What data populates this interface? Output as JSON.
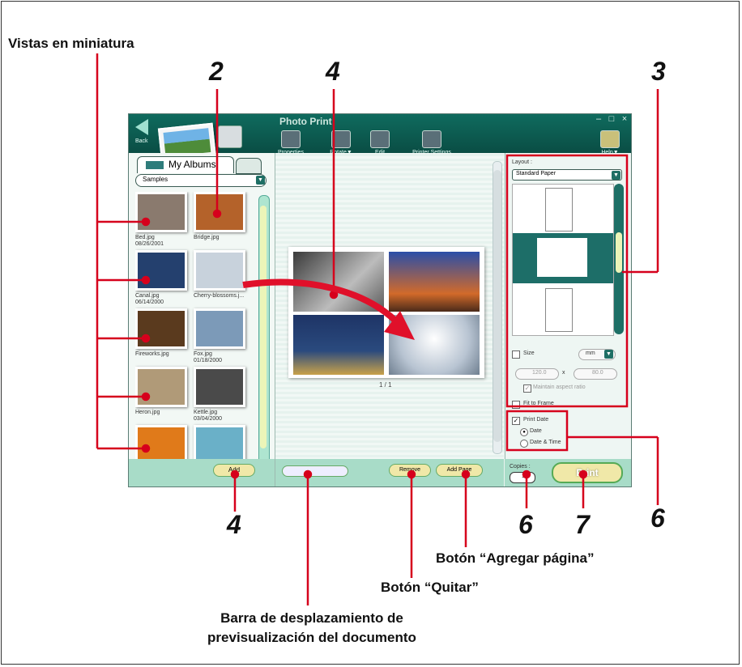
{
  "annotations": {
    "thumbnails_label": "Vistas en miniatura",
    "callout_2": "2",
    "callout_4_top": "4",
    "callout_3": "3",
    "callout_4_bottom": "4",
    "callout_6_right": "6",
    "callout_6_bottom": "6",
    "callout_7": "7",
    "add_page_label": "Botón “Agregar página”",
    "remove_label": "Botón “Quitar”",
    "scrollbar_caption_line1": "Barra de desplazamiento de",
    "scrollbar_caption_line2": "previsualización del documento"
  },
  "window": {
    "title": "Photo Print",
    "back_label": "Back",
    "help_label": "Help▼",
    "toolbar": [
      {
        "label": "Properties"
      },
      {
        "label": "Rotate▼"
      },
      {
        "label": "Edit"
      },
      {
        "label": "Printer Settings"
      }
    ]
  },
  "left_panel": {
    "tab_label": "My Albums",
    "album_select": "Samples",
    "thumbnails": [
      {
        "name": "Bed.jpg",
        "date": "08/26/2001",
        "color": "#8a7a6e"
      },
      {
        "name": "Bridge.jpg",
        "date": "",
        "color": "#b4622a"
      },
      {
        "name": "Canal.jpg",
        "date": "06/14/2000",
        "color": "#24406e"
      },
      {
        "name": "Cherry-blossoms.j...",
        "date": "",
        "color": "#c8d2dc"
      },
      {
        "name": "Fireworks.jpg",
        "date": "",
        "color": "#5a3a1e"
      },
      {
        "name": "Fox.jpg",
        "date": "01/18/2000",
        "color": "#7c9ab8"
      },
      {
        "name": "Heron.jpg",
        "date": "",
        "color": "#b09a78"
      },
      {
        "name": "Kettle.jpg",
        "date": "03/04/2000",
        "color": "#4a4a4a"
      },
      {
        "name": "",
        "date": "",
        "color": "#e07a1a"
      },
      {
        "name": "",
        "date": "",
        "color": "#6ab0c8"
      }
    ],
    "add_button": "Add"
  },
  "center": {
    "page_number": "1 / 1",
    "remove_button": "Remove",
    "add_page_button": "Add Page"
  },
  "right_panel": {
    "layout_label": "Layout :",
    "layout_select": "Standard Paper",
    "size_label": "Size",
    "unit": "mm",
    "width": "120.0",
    "height": "80.0",
    "x_sep": "x",
    "maintain_aspect": "Maintain aspect ratio",
    "fit_to_frame": "Fit to Frame",
    "print_date": "Print Date",
    "date_option": "Date",
    "date_time_option": "Date & Time",
    "copies_label": "Copies :",
    "copies_value": "1",
    "print_button": "Print"
  }
}
